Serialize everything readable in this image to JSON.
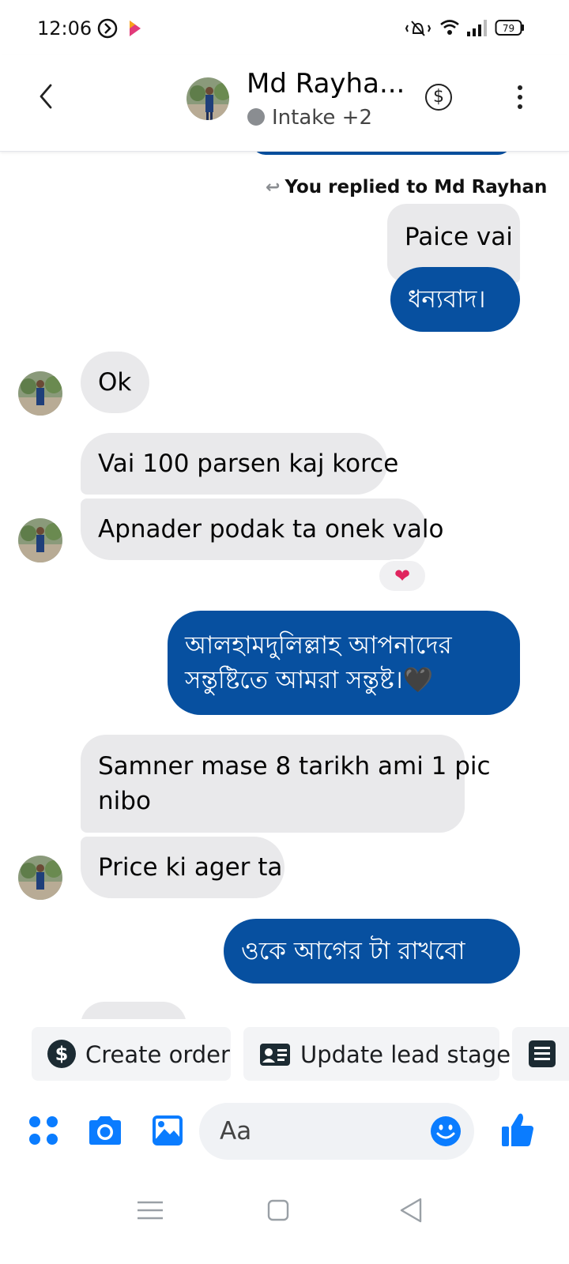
{
  "status_bar": {
    "time": "12:06",
    "battery": "79"
  },
  "header": {
    "contact_name": "Md Rayha...",
    "subtitle": "Intake +2",
    "status_dot_color": "#8a8d91"
  },
  "conversation": {
    "replied_note": "You replied to Md Rayhan",
    "quoted_text": "Paice vai",
    "messages": [
      {
        "dir": "out",
        "text": "ধন্যবাদ।"
      },
      {
        "dir": "in",
        "text": "Ok"
      },
      {
        "dir": "in",
        "text": "Vai 100 parsen kaj korce"
      },
      {
        "dir": "in",
        "text": "Apnader podak ta onek valo"
      },
      {
        "dir": "out",
        "line1": "আলহামদুলিল্লাহ আপনাদের",
        "line2": "সন্তুষ্টিতে আমরা সন্তুষ্ট।🖤"
      },
      {
        "dir": "in",
        "line1": "Samner mase 8 tarikh ami 1 pic",
        "line2": "nibo"
      },
      {
        "dir": "in",
        "text": "Price ki ager ta"
      },
      {
        "dir": "out",
        "text": "ওকে আগের টা রাখবো"
      }
    ],
    "reaction": "❤",
    "colors": {
      "outgoing": "#0750a0",
      "incoming": "#e9e9eb",
      "accent": "#0a7cff"
    }
  },
  "quick_actions": {
    "create_order": "Create order",
    "update_lead_stage": "Update lead stage"
  },
  "composer": {
    "placeholder": "Aa"
  },
  "icons": {
    "status": [
      "sync-icon",
      "app-notification-icon",
      "vibrate-icon",
      "wifi-icon",
      "signal-icon",
      "battery-icon"
    ],
    "header": [
      "back-arrow-icon",
      "avatar",
      "dollar-icon",
      "more-vertical-icon"
    ],
    "composer": [
      "apps-grid-icon",
      "camera-icon",
      "gallery-icon",
      "emoji-icon",
      "thumbs-up-icon"
    ],
    "navigation": [
      "menu-icon",
      "home-icon",
      "back-icon"
    ]
  }
}
